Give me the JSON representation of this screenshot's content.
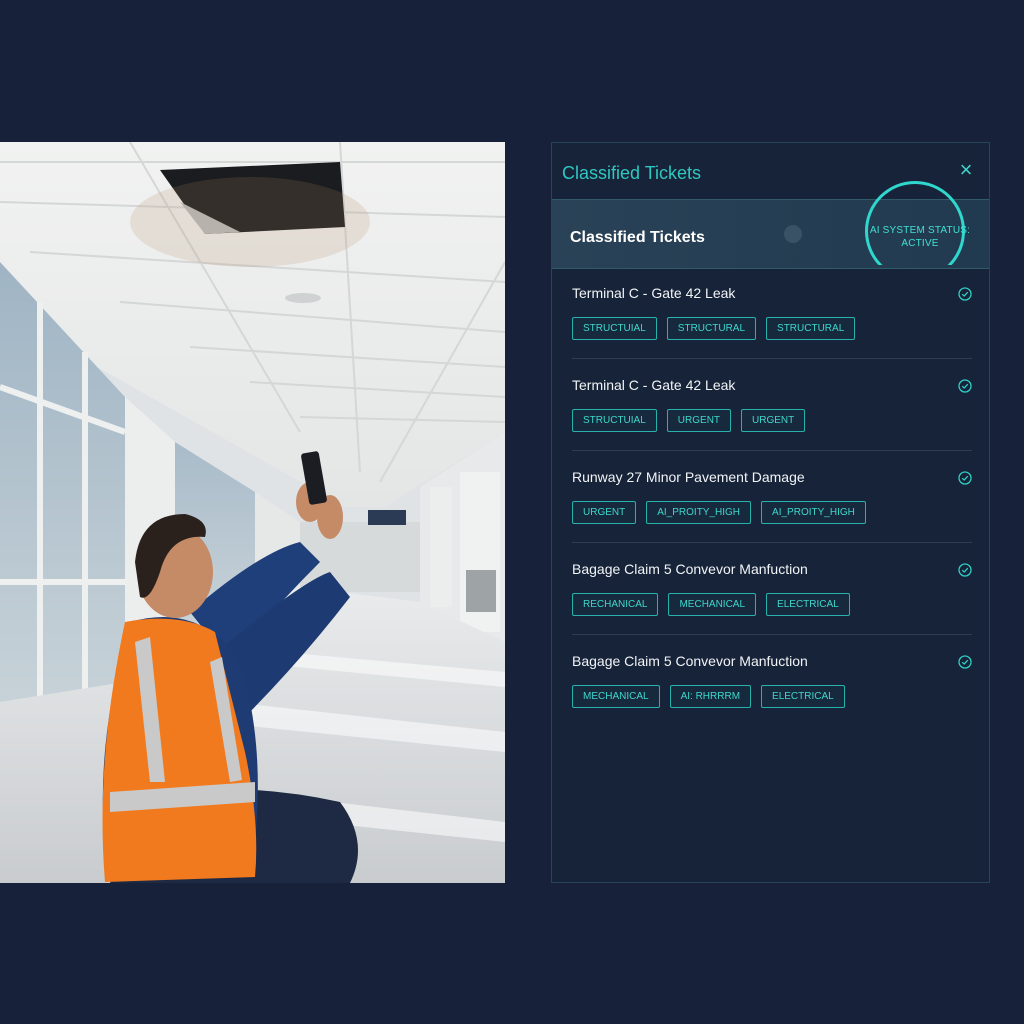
{
  "panel": {
    "title": "Classified Tickets",
    "close_icon": "close-icon",
    "header_title": "Classified Tickets",
    "status_line1": "AI SYSTEM STATUS:",
    "status_line2": "ACTIVE"
  },
  "tickets": [
    {
      "title": "Terminal C - Gate 42 Leak",
      "tags": [
        "STRUCTUIAL",
        "STRUCTURAL",
        "STRUCTURAL"
      ]
    },
    {
      "title": "Terminal C - Gate 42 Leak",
      "tags": [
        "STRUCTUIAL",
        "URGENT",
        "URGENT"
      ]
    },
    {
      "title": "Runway 27 Minor Pavement Damage",
      "tags": [
        "URGENT",
        "AI_PROITY_HIGH",
        "AI_PROITY_HIGH"
      ]
    },
    {
      "title": "Bagage Claim 5 Convevor Manfuction",
      "tags": [
        "RECHANICAL",
        "MECHANICAL",
        "ELECTRICAL"
      ]
    },
    {
      "title": "Bagage Claim 5 Convevor Manfuction",
      "tags": [
        "MECHANICAL",
        "AI: RHRRRM",
        "ELECTRICAL"
      ]
    }
  ],
  "colors": {
    "background": "#17223a",
    "accent": "#2ec8c0",
    "tag_border": "#27b3ac",
    "vest": "#f27a1e"
  },
  "icons": [
    "close-icon",
    "check-circle-icon"
  ]
}
